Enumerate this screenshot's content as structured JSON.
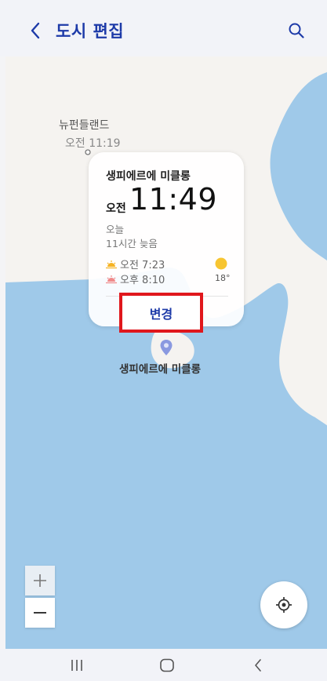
{
  "header": {
    "title": "도시 편집",
    "back_icon": "chevron-left-icon",
    "search_icon": "search-icon"
  },
  "map": {
    "nearby_city": {
      "name": "뉴펀들랜드",
      "time": "오전 11:19"
    },
    "pin_label": "생피에르에 미클롱"
  },
  "card": {
    "city": "생피에르에 미클롱",
    "ampm": "오전",
    "time": "11:49",
    "day": "오늘",
    "difference": "11시간 늦음",
    "sunrise": "오전 7:23",
    "sunset": "오후 8:10",
    "temperature": "18°",
    "change_label": "변경"
  },
  "controls": {
    "zoom_in_icon": "plus-icon",
    "zoom_out_icon": "minus-icon",
    "locate_icon": "crosshair-icon"
  },
  "colors": {
    "accent": "#1d3aa8",
    "highlight_border": "#e0171c",
    "water": "#9fc9e9",
    "land": "#f5f3f0"
  }
}
